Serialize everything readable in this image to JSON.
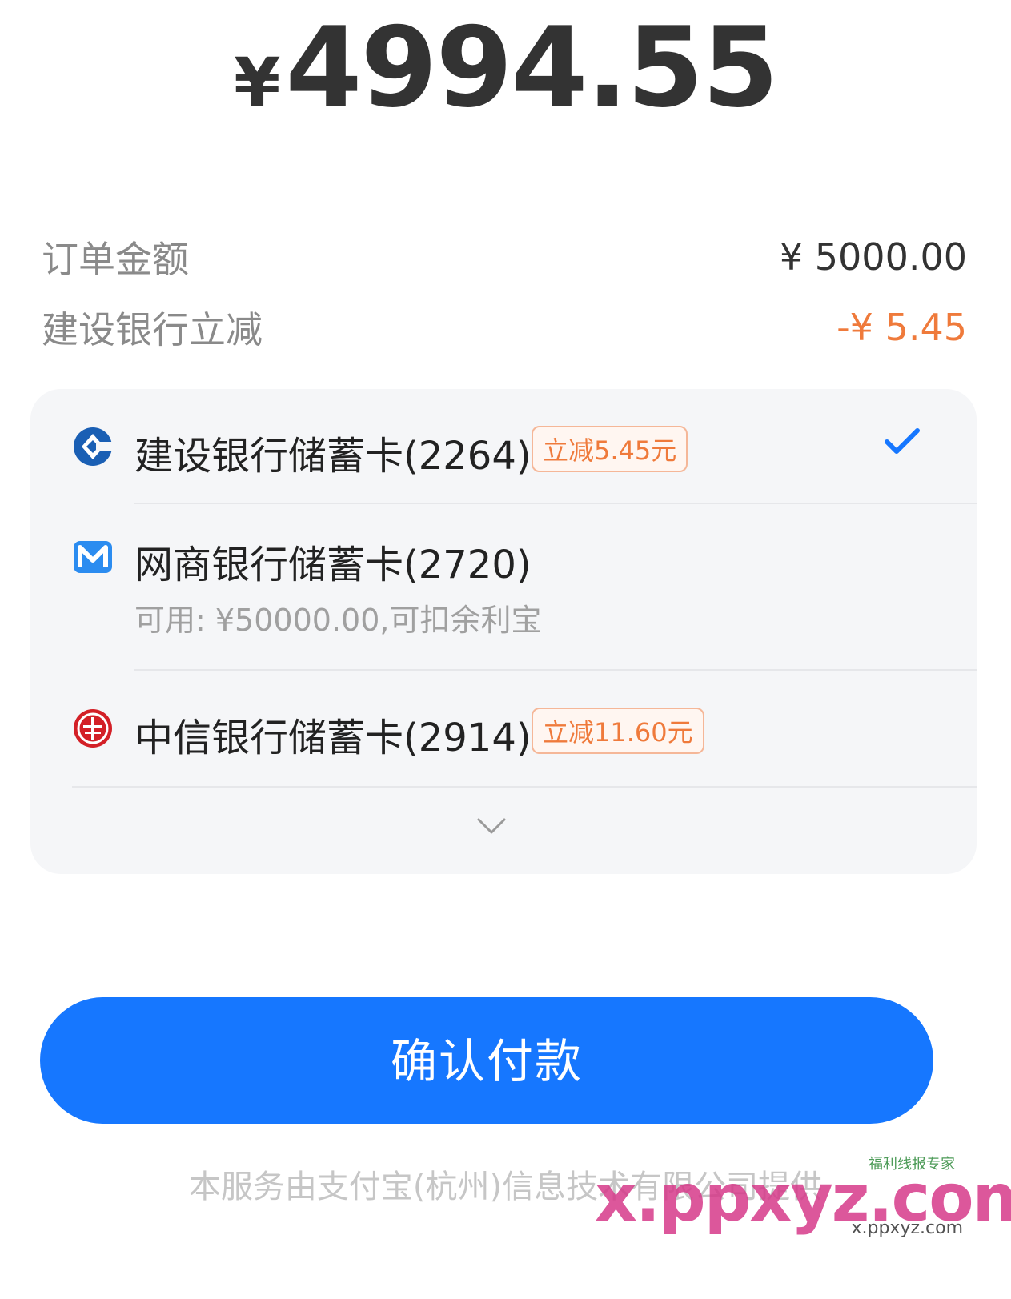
{
  "total": {
    "currency": "¥",
    "amount": "4994.55"
  },
  "details": {
    "order_label": "订单金额",
    "order_value": "¥ 5000.00",
    "discount_label": "建设银行立减",
    "discount_value": "-¥ 5.45"
  },
  "cards": [
    {
      "name": "建设银行储蓄卡(2264)",
      "promo": "立减5.45元",
      "selected": true,
      "icon": "ccb-bank-icon"
    },
    {
      "name": "网商银行储蓄卡(2720)",
      "sub": "可用: ¥50000.00,可扣余利宝",
      "icon": "mybank-icon"
    },
    {
      "name": "中信银行储蓄卡(2914)",
      "promo": "立减11.60元",
      "icon": "citic-bank-icon"
    }
  ],
  "expand_icon": "chevron-down-icon",
  "pay_button": "确认付款",
  "footer": "本服务由支付宝(杭州)信息技术有限公司提供",
  "watermark": {
    "main": "x.ppxyz.com",
    "sub": "x.ppxyz.com",
    "tag": "福利线报专家"
  },
  "colors": {
    "primary": "#1677ff",
    "discount": "#ef7a3b",
    "panel_bg": "#f5f6f8"
  }
}
